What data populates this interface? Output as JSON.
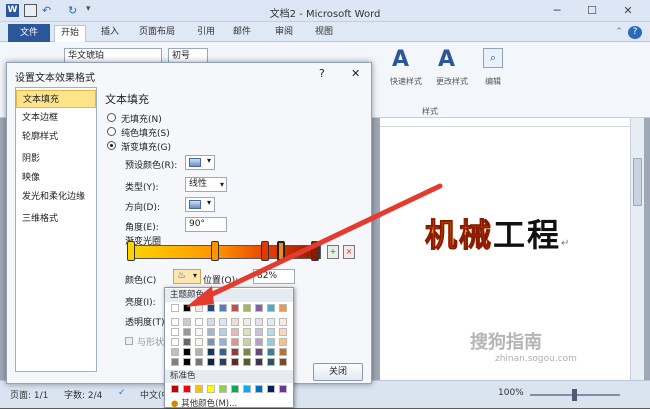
{
  "window": {
    "title": "文档2 - Microsoft Word",
    "minimize": "─",
    "restore": "☐",
    "close": "✕"
  },
  "quick_access": {
    "undo": "↶",
    "redo": "↻",
    "menu": "▾"
  },
  "tabs": [
    "文件",
    "开始",
    "插入",
    "页面布局",
    "引用",
    "邮件",
    "审阅",
    "视图"
  ],
  "ribbon": {
    "font_name": "华文琥珀",
    "font_size": "初号",
    "styles_btn1": "快速样式",
    "styles_btn2": "更改样式",
    "styles_group": "样式",
    "edit_btn": "编辑"
  },
  "dialog": {
    "title": "设置文本效果格式",
    "help": "?",
    "close": "✕",
    "nav": [
      "文本填充",
      "文本边框",
      "轮廓样式",
      "阴影",
      "映像",
      "发光和柔化边缘",
      "三维格式"
    ],
    "section_title": "文本填充",
    "options": [
      "无填充(N)",
      "纯色填充(S)",
      "渐变填充(G)"
    ],
    "preset_label": "预设颜色(R):",
    "type_label": "类型(Y):",
    "type_value": "线性",
    "direction_label": "方向(D):",
    "angle_label": "角度(E):",
    "angle_value": "90°",
    "gradient_label": "渐变光圈",
    "color_label": "颜色(C)",
    "position_label": "位置(O):",
    "position_value": "82%",
    "brightness_label": "亮度(I):",
    "transparency_label": "透明度(T):",
    "rotate_label": "与形状一起旋转",
    "close_button": "关闭"
  },
  "color_popup": {
    "theme_label": "主题颜色",
    "standard_label": "标准色",
    "more_label": "其他颜色(M)..."
  },
  "document": {
    "wordart_colored": "机械",
    "wordart_black": "工程",
    "para_mark": "↵"
  },
  "status": {
    "page": "页面: 1/1",
    "words": "字数: 2/4",
    "lang": "中文(中国)",
    "zoom": "100%"
  },
  "watermark": {
    "brand": "搜狗指南",
    "url": "zhinan.sogou.com"
  },
  "colors": {
    "theme_top": [
      "#ffffff",
      "#000000",
      "#eeece1",
      "#1f497d",
      "#4f81bd",
      "#c0504d",
      "#9bbb59",
      "#8064a2",
      "#4bacc6",
      "#f79646"
    ],
    "standard": [
      "#c00000",
      "#ff0000",
      "#ffc000",
      "#ffff00",
      "#92d050",
      "#00b050",
      "#00b0f0",
      "#0070c0",
      "#002060",
      "#7030a0"
    ]
  }
}
